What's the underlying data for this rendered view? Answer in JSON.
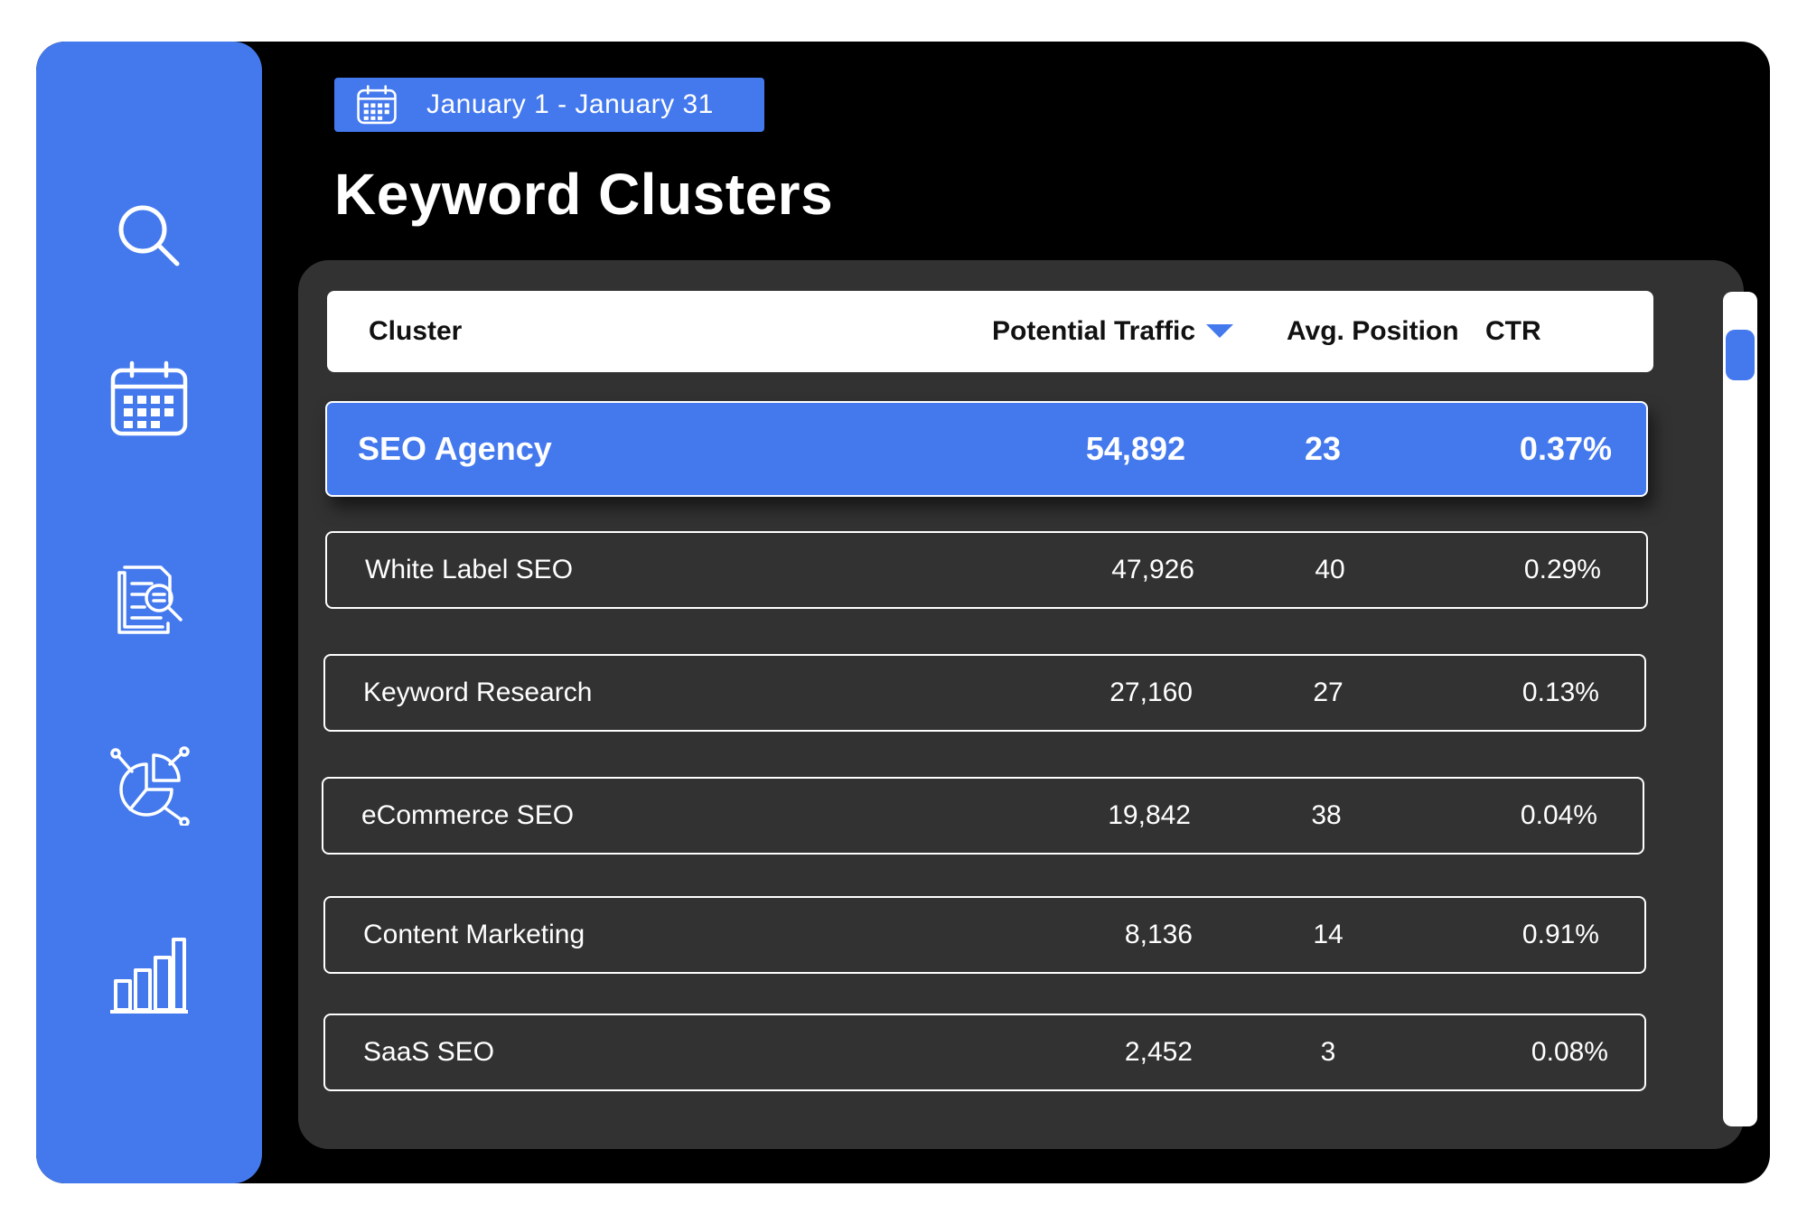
{
  "colors": {
    "accent": "#4479ee",
    "background": "#000000",
    "panel": "#323232",
    "text": "#ffffff"
  },
  "sidebar": {
    "icons": [
      "search-icon",
      "calendar-icon",
      "document-search-icon",
      "pie-chart-network-icon",
      "bar-chart-icon"
    ]
  },
  "date_range": {
    "icon": "calendar-icon",
    "label": "January 1 - January 31"
  },
  "page": {
    "title": "Keyword Clusters"
  },
  "table": {
    "columns": {
      "cluster": "Cluster",
      "traffic": "Potential Traffic",
      "position": "Avg. Position",
      "ctr": "CTR"
    },
    "sort": {
      "column": "Potential Traffic",
      "direction": "descending",
      "icon": "sort-down-icon"
    },
    "rows": [
      {
        "name": "SEO Agency",
        "traffic": "54,892",
        "position": "23",
        "ctr": "0.37%",
        "selected": true
      },
      {
        "name": "White Label SEO",
        "traffic": "47,926",
        "position": "40",
        "ctr": "0.29%"
      },
      {
        "name": "Keyword Research",
        "traffic": "27,160",
        "position": "27",
        "ctr": "0.13%"
      },
      {
        "name": "eCommerce SEO",
        "traffic": "19,842",
        "position": "38",
        "ctr": "0.04%"
      },
      {
        "name": "Content Marketing",
        "traffic": "8,136",
        "position": "14",
        "ctr": "0.91%"
      },
      {
        "name": "SaaS SEO",
        "traffic": "2,452",
        "position": "3",
        "ctr": "0.08%"
      }
    ]
  }
}
